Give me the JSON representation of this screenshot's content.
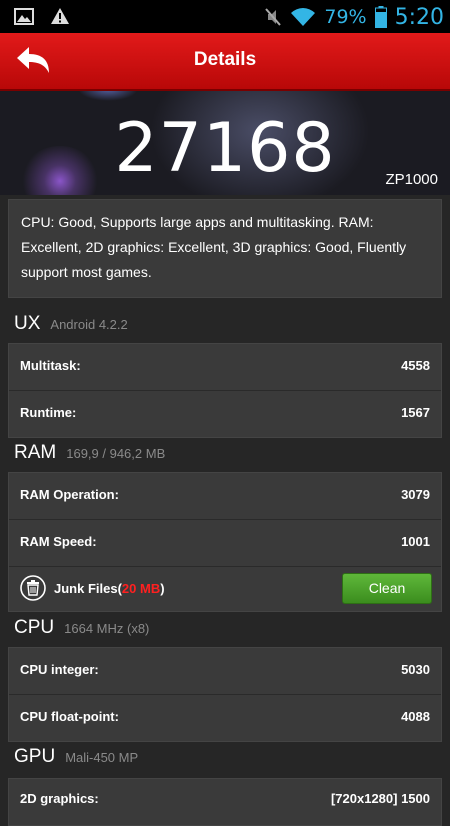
{
  "status_bar": {
    "icons_left": [
      "image-icon",
      "warning-icon"
    ],
    "icons_right": [
      "mute-icon",
      "wifi-icon",
      "battery-icon"
    ],
    "battery": "79%",
    "time": "5:20"
  },
  "header": {
    "title": "Details"
  },
  "score": {
    "value": "27168",
    "device": "ZP1000"
  },
  "summary": "CPU: Good, Supports large apps and multitasking. RAM: Excellent, 2D graphics: Excellent, 3D graphics: Good, Fluently support most games.",
  "sections": {
    "ux": {
      "title": "UX",
      "subtitle": "Android 4.2.2",
      "rows": [
        {
          "label": "Multitask:",
          "value": "4558"
        },
        {
          "label": "Runtime:",
          "value": "1567"
        }
      ]
    },
    "ram": {
      "title": "RAM",
      "subtitle": "169,9 / 946,2 MB",
      "rows": [
        {
          "label": "RAM Operation:",
          "value": "3079"
        },
        {
          "label": "RAM Speed:",
          "value": "1001"
        }
      ],
      "junk": {
        "label": "Junk Files(",
        "size": "20 MB",
        "close": ")",
        "button": "Clean"
      }
    },
    "cpu": {
      "title": "CPU",
      "subtitle": "1664 MHz (x8)",
      "rows": [
        {
          "label": "CPU integer:",
          "value": "5030"
        },
        {
          "label": "CPU float-point:",
          "value": "4088"
        }
      ]
    },
    "gpu": {
      "title": "GPU",
      "subtitle": "Mali-450 MP",
      "rows": [
        {
          "label": "2D graphics:",
          "value": "[720x1280] 1500"
        }
      ]
    }
  },
  "colors": {
    "accent_red": "#d01010",
    "status_blue": "#33b5e5",
    "clean_green": "#4aa02a",
    "junk_red": "#ff2020"
  }
}
